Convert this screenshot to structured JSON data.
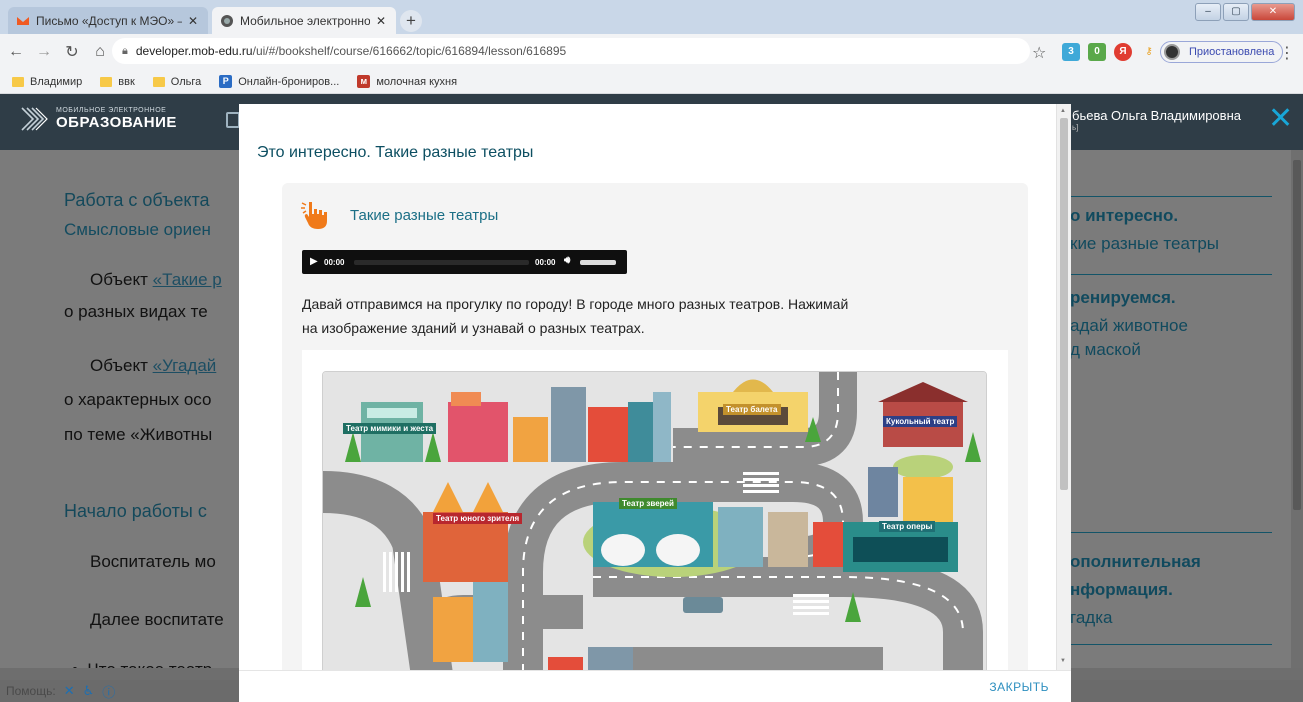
{
  "browser": {
    "tabs": [
      {
        "title": "Письмо «Доступ к МЭО» — Род"
      },
      {
        "title": "Мобильное электронное обра"
      }
    ],
    "url_host": "developer.mob-edu.ru",
    "url_path": "/ui/#/bookshelf/course/616662/topic/616894/lesson/616895",
    "profile_label": "Приостановлена",
    "bookmarks": [
      "Владимир",
      "ввк",
      "Ольга",
      "Онлайн-брониров...",
      "молочная кухня"
    ]
  },
  "site": {
    "logo_top": "МОБИЛЬНОЕ ЭЛЕКТРОННОЕ",
    "logo_bottom": "ОБРАЗОВАНИЕ",
    "user_name": "бьева Ольга Владимировна",
    "user_sub": "ь]"
  },
  "background_page": {
    "left": {
      "heading1": "Работа с объекта",
      "sub1": "Смысловые ориен",
      "p1_prefix": "Объект ",
      "p1_link": "«Такие р",
      "p1_line2": "о разных видах те",
      "p2_prefix": "Объект ",
      "p2_link": "«Угадай",
      "p2_line2": "о характерных осо",
      "p2_line3": "по теме «Животны",
      "heading2": "Начало работы с",
      "p3": "Воспитатель мо",
      "p4": "Далее воспитате",
      "bullet1": "Что такое театр"
    },
    "right": {
      "item1_title": "о интересно.",
      "item1_sub": "кие разные театры",
      "item2_title": "ренируемся.",
      "item2_sub1": "адай животное",
      "item2_sub2": "д маской",
      "item3_title1": "ополнительная",
      "item3_title2": "нформация.",
      "item3_sub": "гадка"
    },
    "footer_label": "Помощь:"
  },
  "modal": {
    "title": "Это интересно. Такие разные театры",
    "card_title": "Такие разные театры",
    "audio": {
      "current": "00:00",
      "duration": "00:00"
    },
    "description_line1": "Давай отправимся на прогулку по городу! В городе много разных театров. Нажимай",
    "description_line2": "на изображение зданий и узнавай о разных театрах.",
    "close_label": "ЗАКРЫТЬ",
    "map_labels": {
      "mime": "Театр мимики и жеста",
      "ballet": "Театр балета",
      "puppet": "Кукольный театр",
      "animals": "Театр зверей",
      "youth": "Театр юного зрителя",
      "opera": "Театр оперы"
    }
  },
  "colors": {
    "accent": "#1b6f86",
    "title": "#0d4f62",
    "header_bg": "#2f3d47",
    "overlay_bg": "#7b7b7b",
    "close_x": "#18a7d8"
  }
}
